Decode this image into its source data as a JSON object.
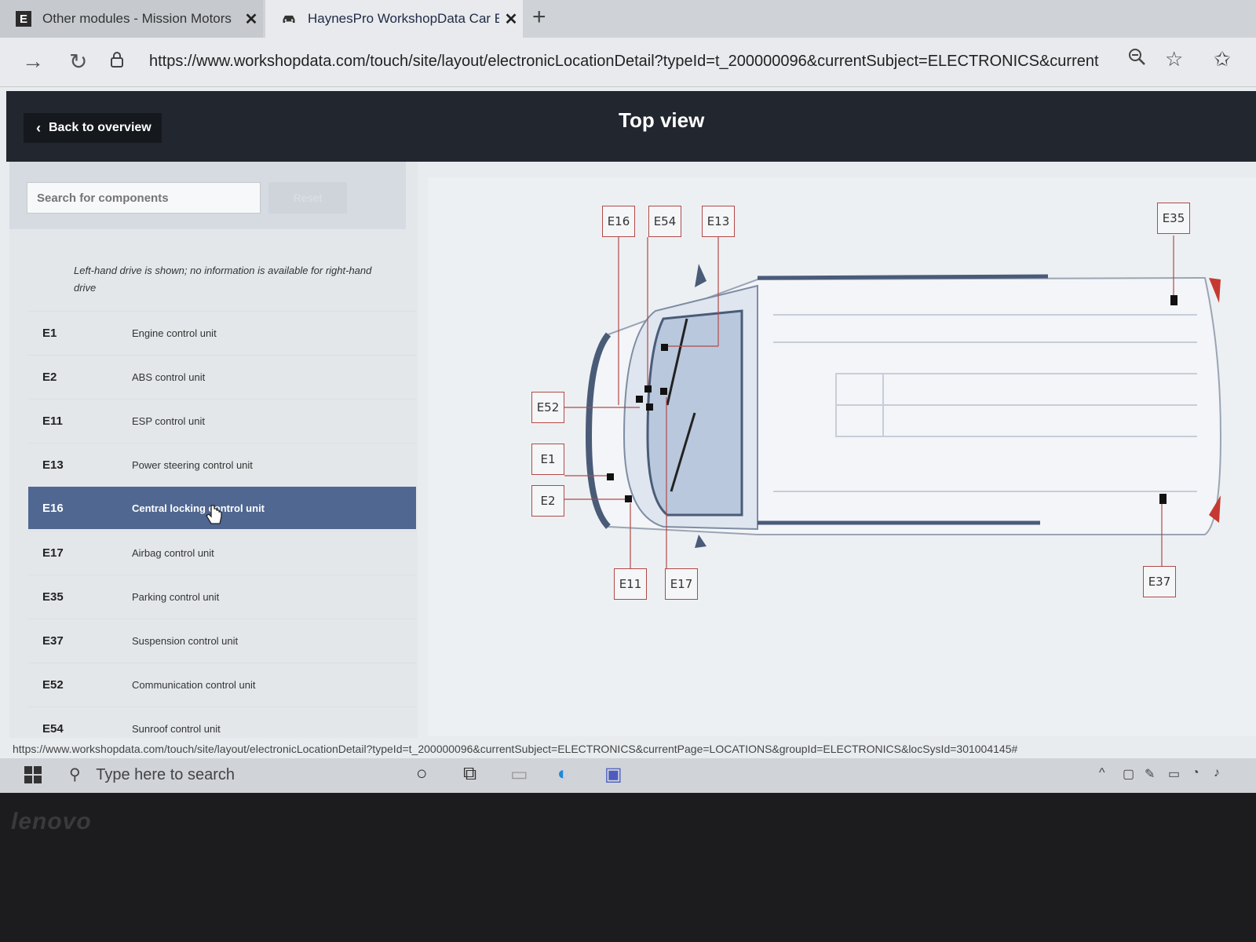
{
  "browser": {
    "tabs": [
      {
        "label": "Other modules - Mission Motors",
        "icon": "E",
        "active": false
      },
      {
        "label": "HaynesPro WorkshopData Car Ec",
        "icon": "car-icon",
        "active": true
      }
    ],
    "url": "https://www.workshopdata.com/touch/site/layout/electronicLocationDetail?typeId=t_200000096&currentSubject=ELECTRONICS&currentPage=L..."
  },
  "header": {
    "back_label": "Back to overview",
    "title": "Top view"
  },
  "search": {
    "placeholder": "Search for components",
    "reset_label": "Reset"
  },
  "note": "Left-hand drive is shown; no information is available for right-hand drive",
  "components": [
    {
      "code": "E1",
      "name": "Engine control unit"
    },
    {
      "code": "E2",
      "name": "ABS control unit"
    },
    {
      "code": "E11",
      "name": "ESP control unit"
    },
    {
      "code": "E13",
      "name": "Power steering control unit"
    },
    {
      "code": "E16",
      "name": "Central locking control unit",
      "selected": true
    },
    {
      "code": "E17",
      "name": "Airbag control unit"
    },
    {
      "code": "E35",
      "name": "Parking control unit"
    },
    {
      "code": "E37",
      "name": "Suspension control unit"
    },
    {
      "code": "E52",
      "name": "Communication control unit"
    },
    {
      "code": "E54",
      "name": "Sunroof control unit"
    }
  ],
  "diagram_labels": {
    "e16": "E16",
    "e54": "E54",
    "e13": "E13",
    "e35": "E35",
    "e52": "E52",
    "e1": "E1",
    "e2": "E2",
    "e11": "E11",
    "e17": "E17",
    "e37": "E37"
  },
  "status_url": "https://www.workshopdata.com/touch/site/layout/electronicLocationDetail?typeId=t_200000096&currentSubject=ELECTRONICS&currentPage=LOCATIONS&groupId=ELECTRONICS&locSysId=301004145#",
  "taskbar": {
    "search_placeholder": "Type here to search"
  },
  "laptop_brand": "lenovo",
  "colors": {
    "header_bg": "#22262e",
    "selected_row": "#4f6791",
    "callout_border": "#b04a48"
  }
}
